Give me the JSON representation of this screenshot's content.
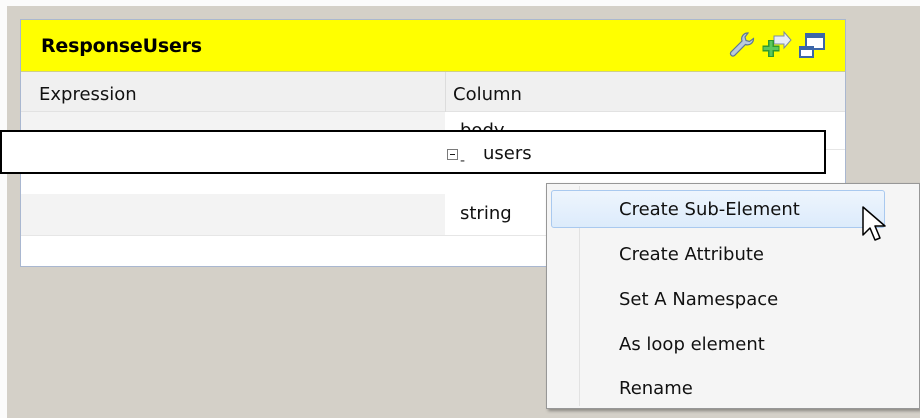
{
  "panel": {
    "title": "ResponseUsers",
    "header_color": "#ffff00",
    "icons": [
      "wrench-icon",
      "add-arrow-icon",
      "window-icon"
    ]
  },
  "columns": {
    "expression": "Expression",
    "column": "Column"
  },
  "rows": [
    {
      "expression": "",
      "column": "body"
    },
    {
      "expression": "",
      "column": "users",
      "expanded": true,
      "selected": true
    },
    {
      "expression": "",
      "column": "string"
    }
  ],
  "context_menu": {
    "items": [
      {
        "label": "Create Sub-Element",
        "highlighted": true
      },
      {
        "label": "Create Attribute"
      },
      {
        "label": "Set A Namespace"
      },
      {
        "label": "As loop element"
      },
      {
        "label": "Rename"
      }
    ]
  }
}
